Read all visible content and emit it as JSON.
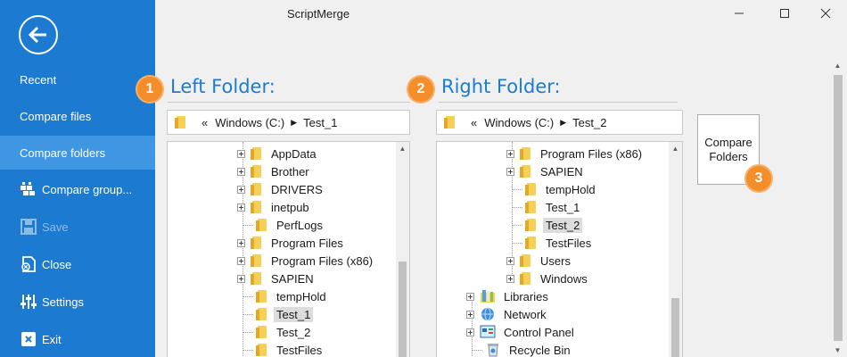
{
  "window": {
    "title": "ScriptMerge"
  },
  "sidebar": {
    "items": [
      {
        "label": "Recent"
      },
      {
        "label": "Compare files"
      },
      {
        "label": "Compare folders"
      },
      {
        "label": "Compare group..."
      },
      {
        "label": "Save"
      },
      {
        "label": "Close"
      },
      {
        "label": "Settings"
      },
      {
        "label": "Exit"
      }
    ]
  },
  "left": {
    "heading": "Left Folder:",
    "badge": "1",
    "path": {
      "prefix": "«",
      "drive": "Windows (C:)",
      "folder": "Test_1"
    },
    "tree": [
      {
        "label": "AppData"
      },
      {
        "label": "Brother"
      },
      {
        "label": "DRIVERS"
      },
      {
        "label": "inetpub"
      },
      {
        "label": "PerfLogs"
      },
      {
        "label": "Program Files"
      },
      {
        "label": "Program Files (x86)"
      },
      {
        "label": "SAPIEN"
      },
      {
        "label": "tempHold"
      },
      {
        "label": "Test_1"
      },
      {
        "label": "Test_2"
      },
      {
        "label": "TestFiles"
      }
    ]
  },
  "right": {
    "heading": "Right Folder:",
    "badge": "2",
    "path": {
      "prefix": "«",
      "drive": "Windows (C:)",
      "folder": "Test_2"
    },
    "tree": [
      {
        "label": "Program Files (x86)"
      },
      {
        "label": "SAPIEN"
      },
      {
        "label": "tempHold"
      },
      {
        "label": "Test_1"
      },
      {
        "label": "Test_2"
      },
      {
        "label": "TestFiles"
      },
      {
        "label": "Users"
      },
      {
        "label": "Windows"
      },
      {
        "label": "Libraries"
      },
      {
        "label": "Network"
      },
      {
        "label": "Control Panel"
      },
      {
        "label": "Recycle Bin"
      }
    ]
  },
  "compare_button": {
    "line1": "Compare",
    "line2": "Folders",
    "badge": "3"
  },
  "colors": {
    "sidebar": "#1c7ad1",
    "accent": "#1b7bd3",
    "badge": "#f38e2b",
    "selected": "#dcdcdc"
  }
}
